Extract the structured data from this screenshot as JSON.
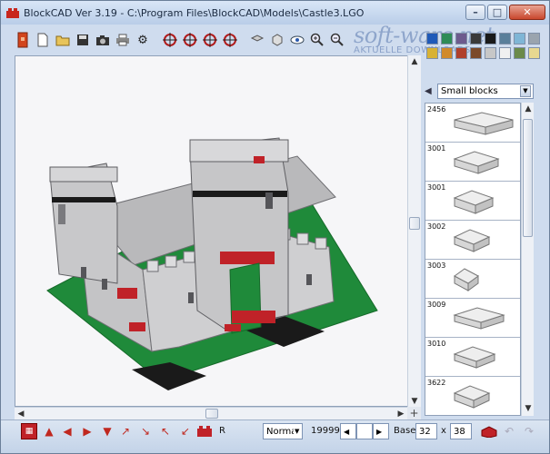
{
  "window": {
    "title": "BlockCAD Ver 3.19 - C:\\Program Files\\BlockCAD\\Models\\Castle3.LGO",
    "controls": {
      "minimize": "–",
      "maximize": "□",
      "close": "✕"
    }
  },
  "watermark": {
    "line1": "soft-ware.net",
    "line2": "AKTUELLE DOWNLOADS"
  },
  "toolbar": {
    "icons": [
      "new-block-icon",
      "new-file-icon",
      "open-folder-icon",
      "save-icon",
      "camera-icon",
      "print-icon",
      "settings-gear-icon",
      "rotate-left-icon",
      "rotate-down-icon",
      "rotate-up-icon",
      "rotate-right-icon",
      "view-top-icon",
      "view-iso-icon",
      "eye-icon",
      "zoom-in-icon",
      "zoom-out-icon"
    ]
  },
  "palette": {
    "colors": [
      "#1f5ab8",
      "#2e8b57",
      "#6d5b8e",
      "#3a3a3a",
      "#1a1a1a",
      "#5a7f9a",
      "#7fb6d6",
      "#9aa4ae",
      "#d8b234",
      "#d08a2c",
      "#b0402c",
      "#7b4a2a",
      "#c7c7c7",
      "#f0f0f0",
      "#6b8a4a",
      "#e8d890"
    ]
  },
  "category": {
    "selected": "Small blocks"
  },
  "parts": [
    {
      "id": "2456"
    },
    {
      "id": "3001"
    },
    {
      "id": "3001"
    },
    {
      "id": "3002"
    },
    {
      "id": "3003"
    },
    {
      "id": "3009"
    },
    {
      "id": "3010"
    },
    {
      "id": "3622"
    }
  ],
  "status": {
    "mode_value": "Normal",
    "counter": "19999",
    "base_label": "Base:",
    "base_x": "32",
    "x_label": "x",
    "base_y": "38",
    "r_label": "R"
  }
}
